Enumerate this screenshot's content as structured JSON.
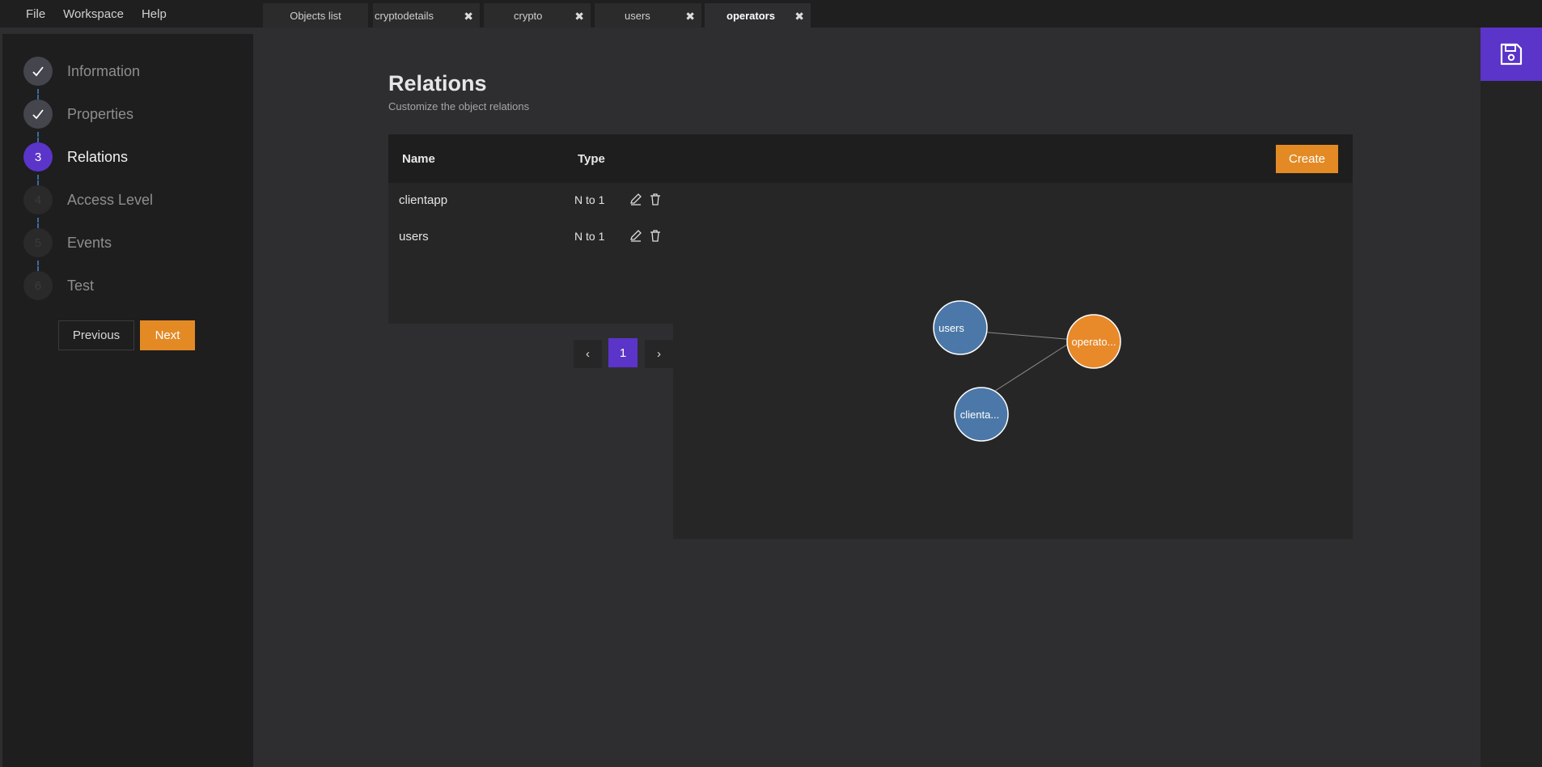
{
  "menu": {
    "file": "File",
    "workspace": "Workspace",
    "help": "Help"
  },
  "tabs": [
    {
      "label": "Objects list",
      "closable": false
    },
    {
      "label": "cryptodetails",
      "closable": true
    },
    {
      "label": "crypto",
      "closable": true
    },
    {
      "label": "users",
      "closable": true
    },
    {
      "label": "operators",
      "closable": true,
      "active": true
    }
  ],
  "tab_close_glyph": "✖",
  "steps": [
    {
      "number": "1",
      "label": "Information",
      "state": "done"
    },
    {
      "number": "2",
      "label": "Properties",
      "state": "done"
    },
    {
      "number": "3",
      "label": "Relations",
      "state": "current"
    },
    {
      "number": "4",
      "label": "Access Level",
      "state": "pending"
    },
    {
      "number": "5",
      "label": "Events",
      "state": "pending"
    },
    {
      "number": "6",
      "label": "Test",
      "state": "pending"
    }
  ],
  "nav": {
    "previous": "Previous",
    "next": "Next"
  },
  "page": {
    "title": "Relations",
    "subtitle": "Customize the object relations"
  },
  "table": {
    "headers": {
      "name": "Name",
      "type": "Type"
    },
    "create_label": "Create",
    "rows": [
      {
        "name": "clientapp",
        "type": "N to 1"
      },
      {
        "name": "users",
        "type": "N to 1"
      }
    ]
  },
  "pagination": {
    "prev": "‹",
    "current": "1",
    "next": "›"
  },
  "graph": {
    "nodes": [
      {
        "id": "users",
        "label": "users",
        "color": "#4b78a8"
      },
      {
        "id": "operators",
        "label": "operato...",
        "color": "#e8892a"
      },
      {
        "id": "clientapp",
        "label": "clienta...",
        "color": "#4b78a8"
      }
    ],
    "edges": [
      {
        "from": "users",
        "to": "operators"
      },
      {
        "from": "clientapp",
        "to": "operators"
      }
    ]
  },
  "colors": {
    "accent": "#5b34c9",
    "action": "#e38a25"
  },
  "icons": {
    "save": "save-icon",
    "check": "check-icon",
    "edit": "edit-icon",
    "delete": "trash-icon"
  }
}
